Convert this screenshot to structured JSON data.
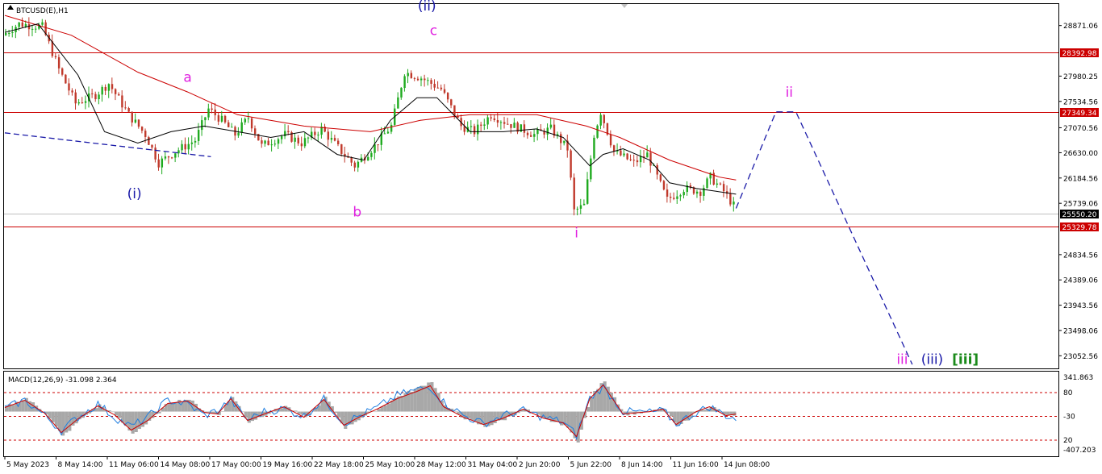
{
  "window": {
    "symbol_label": "BTCUSD(E),H1",
    "macd_label": "MACD(12,26,9) -31.098 2.364"
  },
  "colors": {
    "bull": "#1faa1f",
    "bear": "#c0392b",
    "ma_fast": "#000000",
    "ma_slow": "#cc0000",
    "level_line": "#cc0000",
    "current_line": "#c0c0c0",
    "projection": "#1a1aa8",
    "label_blue": "#1a1aa8",
    "label_magenta": "#e020e0",
    "label_green": "#1a8a1a",
    "macd_hist": "#a8a8a8",
    "macd_signal": "#1e7ee0",
    "macd_ref": "#cc0000"
  },
  "chart_data": {
    "type": "candlestick",
    "price_ylim": [
      22830,
      29250
    ],
    "price_ticks": [
      "28871.06",
      "27980.25",
      "27534.56",
      "27070.56",
      "26630.00",
      "26184.56",
      "25739.06",
      "24834.56",
      "24389.06",
      "23943.56",
      "23498.06",
      "23052.56"
    ],
    "levels": [
      {
        "name": "resistance-1",
        "value": 28392.98,
        "label": "28392.98"
      },
      {
        "name": "resistance-2",
        "value": 27349.34,
        "label": "27349.34"
      },
      {
        "name": "current",
        "value": 25550.2,
        "label": "25550.20"
      },
      {
        "name": "support-1",
        "value": 25329.78,
        "label": "25329.78"
      }
    ],
    "x_ticks": [
      "5 May 2023",
      "8 May 14:00",
      "11 May 06:00",
      "14 May 08:00",
      "17 May 00:00",
      "19 May 16:00",
      "22 May 18:00",
      "25 May 10:00",
      "28 May 12:00",
      "31 May 04:00",
      "2 Jun 20:00",
      "5 Jun 22:00",
      "8 Jun 14:00",
      "11 Jun 16:00",
      "14 Jun 08:00"
    ],
    "bar_count": 220,
    "price_path": [
      [
        0,
        28700
      ],
      [
        5,
        28900
      ],
      [
        12,
        28850
      ],
      [
        17,
        28100
      ],
      [
        22,
        27500
      ],
      [
        28,
        27650
      ],
      [
        32,
        27850
      ],
      [
        38,
        27300
      ],
      [
        43,
        26950
      ],
      [
        47,
        26450
      ],
      [
        52,
        26650
      ],
      [
        58,
        26850
      ],
      [
        62,
        27400
      ],
      [
        66,
        27200
      ],
      [
        70,
        26950
      ],
      [
        74,
        27250
      ],
      [
        78,
        26750
      ],
      [
        85,
        26950
      ],
      [
        90,
        26800
      ],
      [
        96,
        27050
      ],
      [
        102,
        26650
      ],
      [
        106,
        26400
      ],
      [
        112,
        26750
      ],
      [
        117,
        27100
      ],
      [
        121,
        28050
      ],
      [
        126,
        27950
      ],
      [
        132,
        27750
      ],
      [
        138,
        27100
      ],
      [
        142,
        27000
      ],
      [
        147,
        27300
      ],
      [
        152,
        27150
      ],
      [
        160,
        26950
      ],
      [
        165,
        27050
      ],
      [
        170,
        26700
      ],
      [
        172,
        25600
      ],
      [
        175,
        25700
      ],
      [
        178,
        26950
      ],
      [
        180,
        27350
      ],
      [
        184,
        26650
      ],
      [
        190,
        26450
      ],
      [
        194,
        26600
      ],
      [
        197,
        26200
      ],
      [
        200,
        25800
      ],
      [
        205,
        26000
      ],
      [
        210,
        25950
      ],
      [
        213,
        26200
      ],
      [
        217,
        25950
      ],
      [
        220,
        25700
      ]
    ],
    "ma_fast_path": [
      [
        0,
        28750
      ],
      [
        10,
        28900
      ],
      [
        22,
        28000
      ],
      [
        30,
        27000
      ],
      [
        40,
        26800
      ],
      [
        50,
        27000
      ],
      [
        60,
        27100
      ],
      [
        70,
        27000
      ],
      [
        80,
        26900
      ],
      [
        90,
        27000
      ],
      [
        100,
        26600
      ],
      [
        108,
        26500
      ],
      [
        116,
        27200
      ],
      [
        124,
        27600
      ],
      [
        130,
        27600
      ],
      [
        140,
        27000
      ],
      [
        150,
        27000
      ],
      [
        160,
        27050
      ],
      [
        168,
        26900
      ],
      [
        176,
        26400
      ],
      [
        180,
        26600
      ],
      [
        186,
        26700
      ],
      [
        194,
        26500
      ],
      [
        200,
        26100
      ],
      [
        208,
        26000
      ],
      [
        214,
        25950
      ],
      [
        220,
        25900
      ]
    ],
    "ma_slow_path": [
      [
        0,
        29050
      ],
      [
        20,
        28700
      ],
      [
        40,
        28050
      ],
      [
        55,
        27700
      ],
      [
        70,
        27300
      ],
      [
        90,
        27100
      ],
      [
        110,
        27000
      ],
      [
        125,
        27200
      ],
      [
        140,
        27300
      ],
      [
        160,
        27300
      ],
      [
        175,
        27100
      ],
      [
        185,
        26900
      ],
      [
        200,
        26500
      ],
      [
        215,
        26200
      ],
      [
        220,
        26150
      ]
    ],
    "projection_path": [
      [
        220,
        25650
      ],
      [
        232,
        27350
      ],
      [
        238,
        27350
      ],
      [
        273,
        22900
      ]
    ],
    "wave_labels": [
      {
        "text": "(ii)",
        "bar": 127,
        "price": 29140,
        "color": "label_blue"
      },
      {
        "text": "c",
        "bar": 129,
        "price": 28700,
        "color": "label_magenta"
      },
      {
        "text": "a",
        "bar": 55,
        "price": 27880,
        "color": "label_magenta"
      },
      {
        "text": "ii",
        "bar": 236,
        "price": 27620,
        "color": "label_magenta"
      },
      {
        "text": "(i)",
        "bar": 39,
        "price": 25830,
        "color": "label_blue"
      },
      {
        "text": "b",
        "bar": 106,
        "price": 25510,
        "color": "label_magenta"
      },
      {
        "text": "i",
        "bar": 172,
        "price": 25140,
        "color": "label_magenta"
      },
      {
        "text": "iii",
        "bar": 270,
        "price": 22910,
        "color": "label_magenta"
      },
      {
        "text": "(iii)",
        "bar": 279,
        "price": 22910,
        "color": "label_blue"
      },
      {
        "text": "[iii]",
        "bar": 289,
        "price": 22910,
        "color": "label_green"
      }
    ],
    "macd": {
      "ylim": [
        -470,
        420
      ],
      "ticks": [
        "341.863",
        "80",
        "-30",
        "20",
        "-407.203"
      ],
      "ref_levels": [
        200,
        -50,
        -300
      ],
      "hist_path": [
        [
          0,
          50
        ],
        [
          6,
          140
        ],
        [
          12,
          -20
        ],
        [
          17,
          -260
        ],
        [
          22,
          -90
        ],
        [
          28,
          70
        ],
        [
          33,
          -40
        ],
        [
          38,
          -230
        ],
        [
          43,
          -110
        ],
        [
          49,
          100
        ],
        [
          55,
          130
        ],
        [
          60,
          -10
        ],
        [
          64,
          -30
        ],
        [
          68,
          160
        ],
        [
          73,
          -110
        ],
        [
          78,
          -30
        ],
        [
          84,
          60
        ],
        [
          90,
          -70
        ],
        [
          96,
          150
        ],
        [
          102,
          -170
        ],
        [
          107,
          -60
        ],
        [
          112,
          30
        ],
        [
          118,
          160
        ],
        [
          124,
          250
        ],
        [
          128,
          320
        ],
        [
          132,
          60
        ],
        [
          138,
          -70
        ],
        [
          144,
          -160
        ],
        [
          150,
          -80
        ],
        [
          156,
          30
        ],
        [
          162,
          -80
        ],
        [
          168,
          -140
        ],
        [
          172,
          -310
        ],
        [
          176,
          160
        ],
        [
          180,
          330
        ],
        [
          186,
          -30
        ],
        [
          194,
          0
        ],
        [
          198,
          30
        ],
        [
          202,
          -160
        ],
        [
          208,
          0
        ],
        [
          212,
          60
        ],
        [
          217,
          -50
        ],
        [
          220,
          -30
        ]
      ],
      "signal_path": [
        [
          0,
          30
        ],
        [
          6,
          120
        ],
        [
          12,
          -40
        ],
        [
          17,
          -200
        ],
        [
          22,
          -60
        ],
        [
          28,
          80
        ],
        [
          33,
          -60
        ],
        [
          38,
          -160
        ],
        [
          43,
          -60
        ],
        [
          49,
          120
        ],
        [
          55,
          80
        ],
        [
          60,
          -40
        ],
        [
          64,
          10
        ],
        [
          68,
          120
        ],
        [
          73,
          -90
        ],
        [
          78,
          0
        ],
        [
          84,
          30
        ],
        [
          90,
          -50
        ],
        [
          96,
          130
        ],
        [
          102,
          -120
        ],
        [
          107,
          -40
        ],
        [
          112,
          40
        ],
        [
          118,
          170
        ],
        [
          124,
          230
        ],
        [
          128,
          260
        ],
        [
          132,
          100
        ],
        [
          138,
          -40
        ],
        [
          144,
          -130
        ],
        [
          150,
          -40
        ],
        [
          156,
          10
        ],
        [
          162,
          -60
        ],
        [
          168,
          -110
        ],
        [
          172,
          -250
        ],
        [
          176,
          140
        ],
        [
          180,
          260
        ],
        [
          186,
          0
        ],
        [
          194,
          -10
        ],
        [
          198,
          10
        ],
        [
          202,
          -130
        ],
        [
          208,
          -10
        ],
        [
          212,
          50
        ],
        [
          217,
          -40
        ],
        [
          220,
          -80
        ]
      ],
      "last_value_bar": 220,
      "last_value": -150
    }
  }
}
